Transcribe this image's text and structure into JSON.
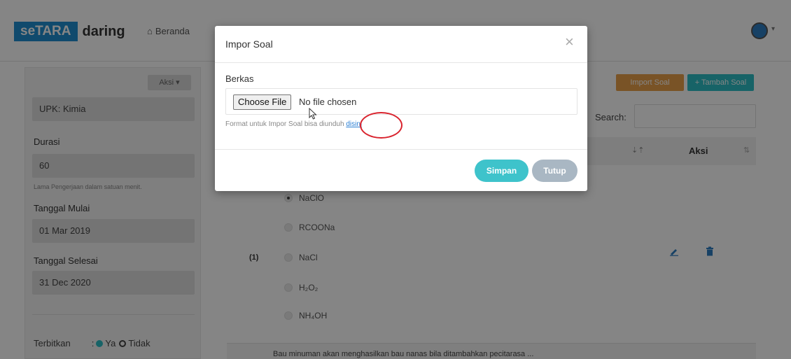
{
  "navbar": {
    "logo_box": "seTARA",
    "logo_word": "daring",
    "nav_home": "Beranda"
  },
  "sidebar": {
    "action_label": "Aksi ▾",
    "upk": "UPK: Kimia",
    "duration_label": "Durasi",
    "duration_value": "60",
    "duration_hint": "Lama Pengerjaan dalam satuan menit.",
    "start_label": "Tanggal Mulai",
    "start_value": "01 Mar 2019",
    "end_label": "Tanggal Selesai",
    "end_value": "31 Dec 2020",
    "publish_label": "Terbitkan",
    "publish_yes": "Ya",
    "publish_no": "Tidak"
  },
  "content": {
    "import_button": "Import Soal",
    "add_button": "+ Tambah Soal",
    "search_label": "Search:",
    "col_action": "Aksi",
    "question_number": "(1)",
    "options": [
      "NaClO",
      "RCOONa",
      "NaCl",
      "H₂O₂",
      "NH₄OH"
    ],
    "next_question": "Bau minuman akan menghasilkan bau nanas bila ditambahkan pecitarasa ..."
  },
  "modal": {
    "title": "Impor Soal",
    "close": "×",
    "file_label": "Berkas",
    "choose_file": "Choose File",
    "no_file": "No file chosen",
    "format_text": "Format untuk Impor Soal bisa diunduh",
    "format_link": "disini",
    "save_button": "Simpan",
    "close_button": "Tutup"
  },
  "colors": {
    "brand": "#1f8fd1",
    "accent_teal": "#3ec3cb",
    "import_orange": "#e9a04a",
    "annotation_red": "#d9232d"
  }
}
